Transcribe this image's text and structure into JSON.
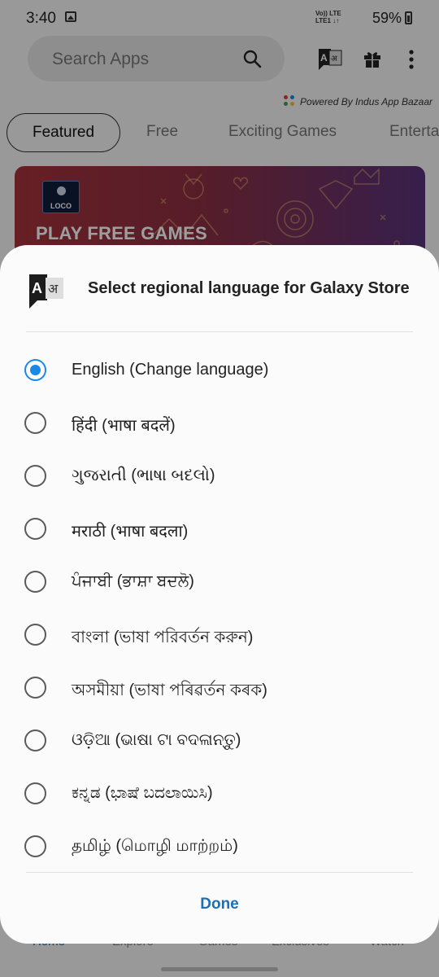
{
  "status_bar": {
    "time": "3:40",
    "network_line1": "Vo)) LTE",
    "network_line2": "LTE1 ↓↑",
    "battery": "59%"
  },
  "search": {
    "placeholder": "Search Apps"
  },
  "powered_by": "Powered By Indus App Bazaar",
  "tabs": [
    {
      "label": "Featured",
      "active": true
    },
    {
      "label": "Free",
      "active": false
    },
    {
      "label": "Exciting Games",
      "active": false
    },
    {
      "label": "Enterta",
      "active": false
    }
  ],
  "banner": {
    "logo_text": "LOCO",
    "title": "PLAY FREE GAMES"
  },
  "bottom_nav": [
    "Home",
    "Explore",
    "Games",
    "Exclusives",
    "Watch"
  ],
  "dialog": {
    "title": "Select regional language for Galaxy Store",
    "options": [
      {
        "label": "English (Change language)",
        "selected": true
      },
      {
        "label": "हिंदी (भाषा बदलें)",
        "selected": false
      },
      {
        "label": "ગુજરાતી (ભાષા બદલો)",
        "selected": false
      },
      {
        "label": "मराठी (भाषा बदला)",
        "selected": false
      },
      {
        "label": "ਪੰਜਾਬੀ (ਭਾਸ਼ਾ ਬਦਲੋ)",
        "selected": false
      },
      {
        "label": "বাংলা (ভাষা পরিবর্তন করুন)",
        "selected": false
      },
      {
        "label": "অসমীয়া (ভাষা পৰিৱৰ্তন কৰক)",
        "selected": false
      },
      {
        "label": "ଓଡ଼ିଆ (ଭାଷା ଟା ବଦଳାନ୍ତୁ)",
        "selected": false
      },
      {
        "label": "ಕನ್ನಡ (ಭಾಷೆ ಬದಲಾಯಿಸಿ)",
        "selected": false
      },
      {
        "label": "தமிழ் (மொழி மாற்றம்)",
        "selected": false
      }
    ],
    "done_label": "Done"
  },
  "colors": {
    "accent": "#1b88e8",
    "done_text": "#1a6fb8",
    "scrim": "rgba(0,0,0,0.38)"
  },
  "icons": [
    "image-icon",
    "battery-icon",
    "search-icon",
    "language-icon",
    "gift-icon",
    "more-vert-icon"
  ]
}
